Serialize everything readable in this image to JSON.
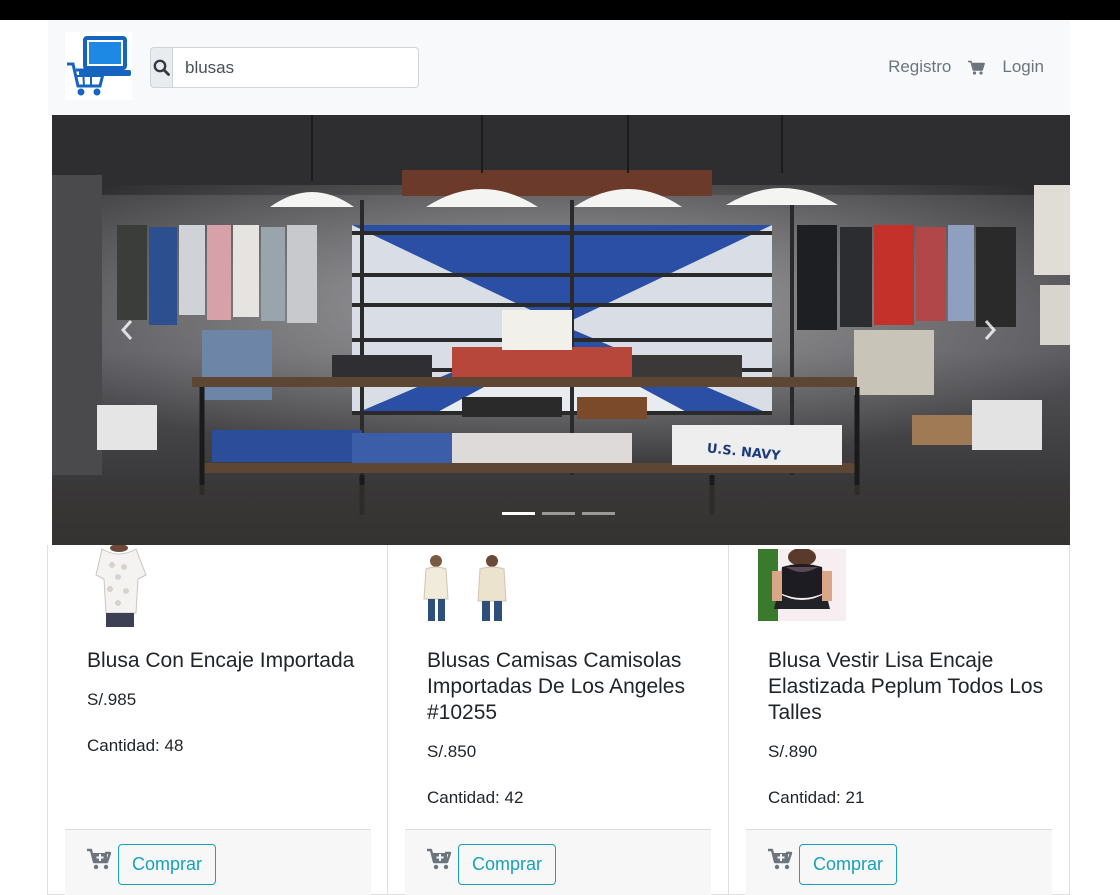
{
  "search": {
    "value": "blusas"
  },
  "nav": {
    "register_label": "Registro",
    "login_label": "Login"
  },
  "carousel": {
    "slide_count": 3,
    "active_index": 0,
    "sign_text": "U.S. NAVY"
  },
  "products": [
    {
      "title": "Blusa Con Encaje Importada",
      "price": "S/.985",
      "quantity": "Cantidad: 48",
      "buy_label": "Comprar"
    },
    {
      "title": "Blusas Camisas Camisolas Importadas De Los Angeles #10255",
      "price": "S/.850",
      "quantity": "Cantidad: 42",
      "buy_label": "Comprar"
    },
    {
      "title": "Blusa Vestir Lisa Encaje Elastizada Peplum Todos Los Talles",
      "price": "S/.890",
      "quantity": "Cantidad: 21",
      "buy_label": "Comprar"
    }
  ],
  "colors": {
    "accent": "#17a2b8",
    "logo_blue": "#1565c0",
    "navbar_bg": "#f8f9fa"
  }
}
